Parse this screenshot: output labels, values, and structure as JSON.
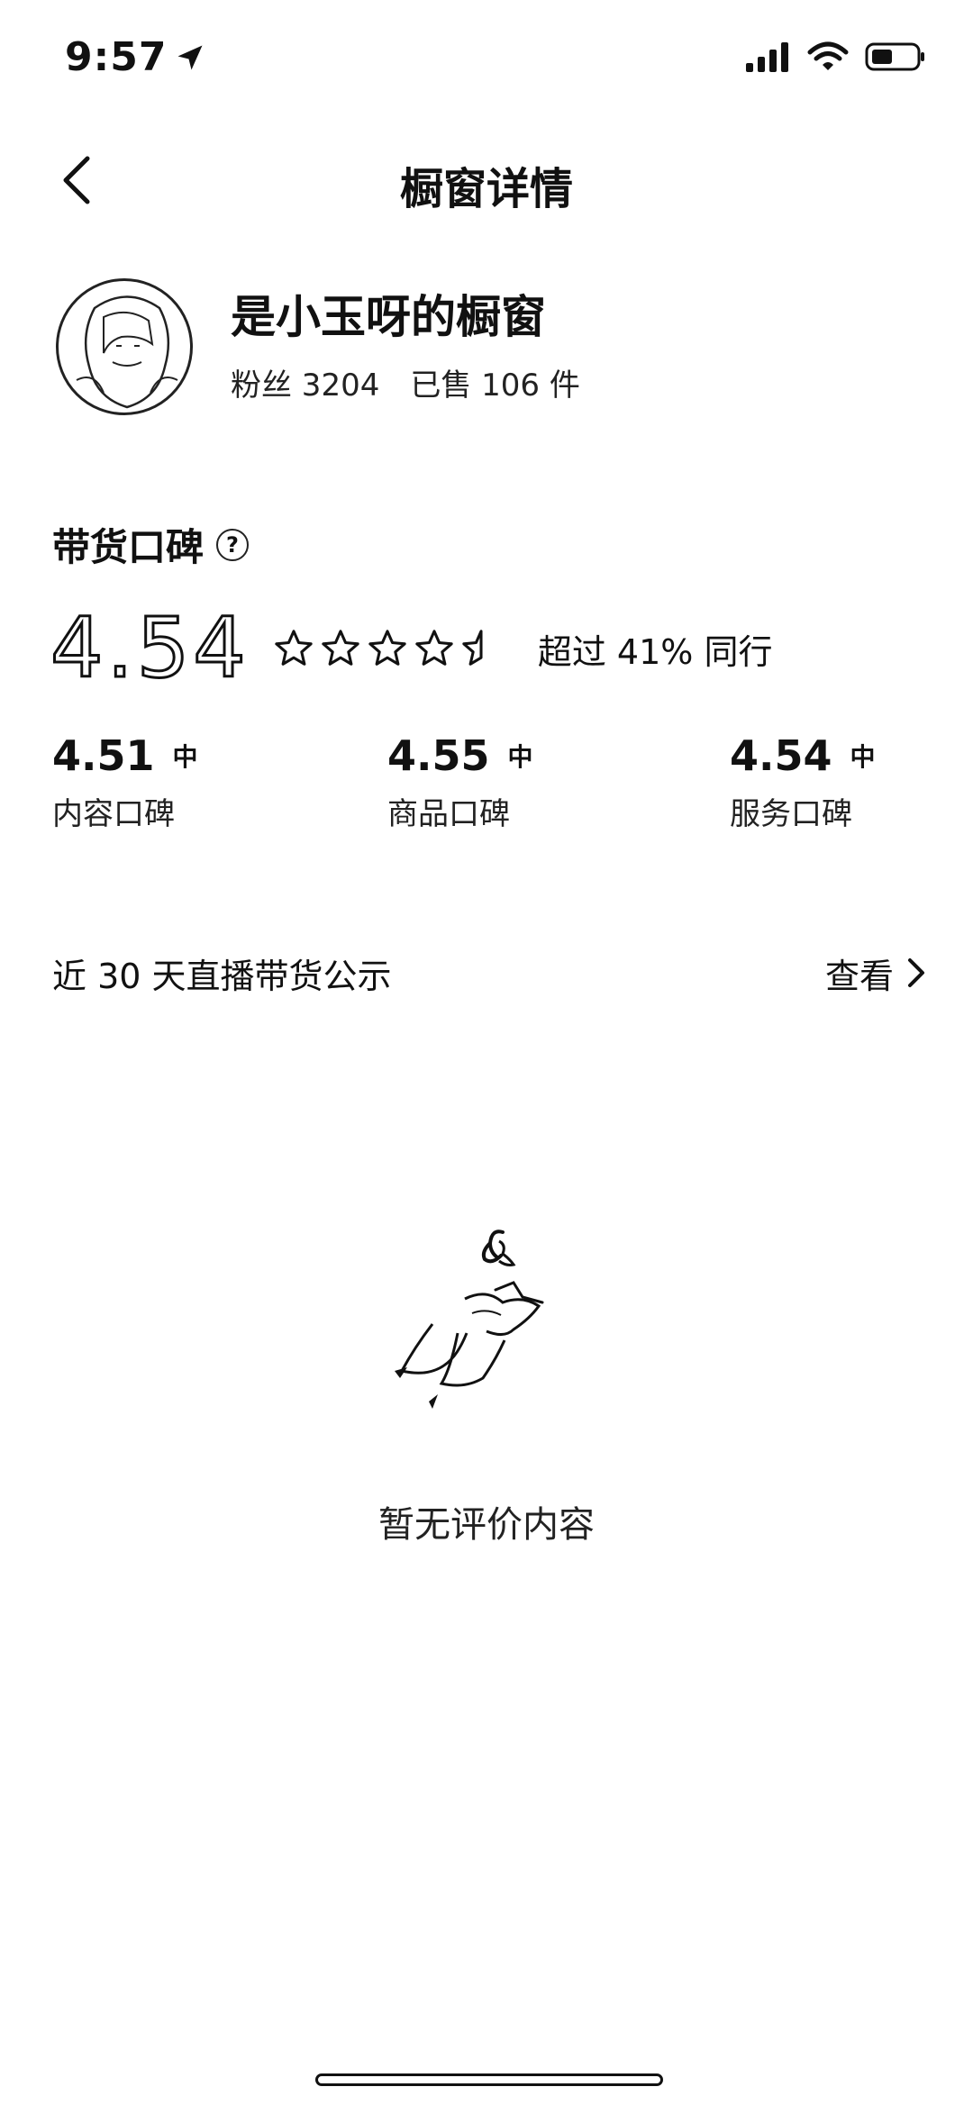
{
  "status_bar": {
    "time": "9:57"
  },
  "nav": {
    "title": "橱窗详情"
  },
  "shop": {
    "name": "是小玉呀的橱窗",
    "fans": "粉丝 3204",
    "sold": "已售 106 件"
  },
  "reputation": {
    "title": "带货口碑",
    "score": "4.54",
    "stars": 4.5,
    "beats_text": "超过 41% 同行",
    "sub_scores": [
      {
        "value": "4.51",
        "level": "中",
        "label": "内容口碑"
      },
      {
        "value": "4.55",
        "level": "中",
        "label": "商品口碑"
      },
      {
        "value": "4.54",
        "level": "中",
        "label": "服务口碑"
      }
    ]
  },
  "live": {
    "title": "近 30 天直播带货公示",
    "view_label": "查看"
  },
  "empty": {
    "text": "暂无评价内容"
  }
}
